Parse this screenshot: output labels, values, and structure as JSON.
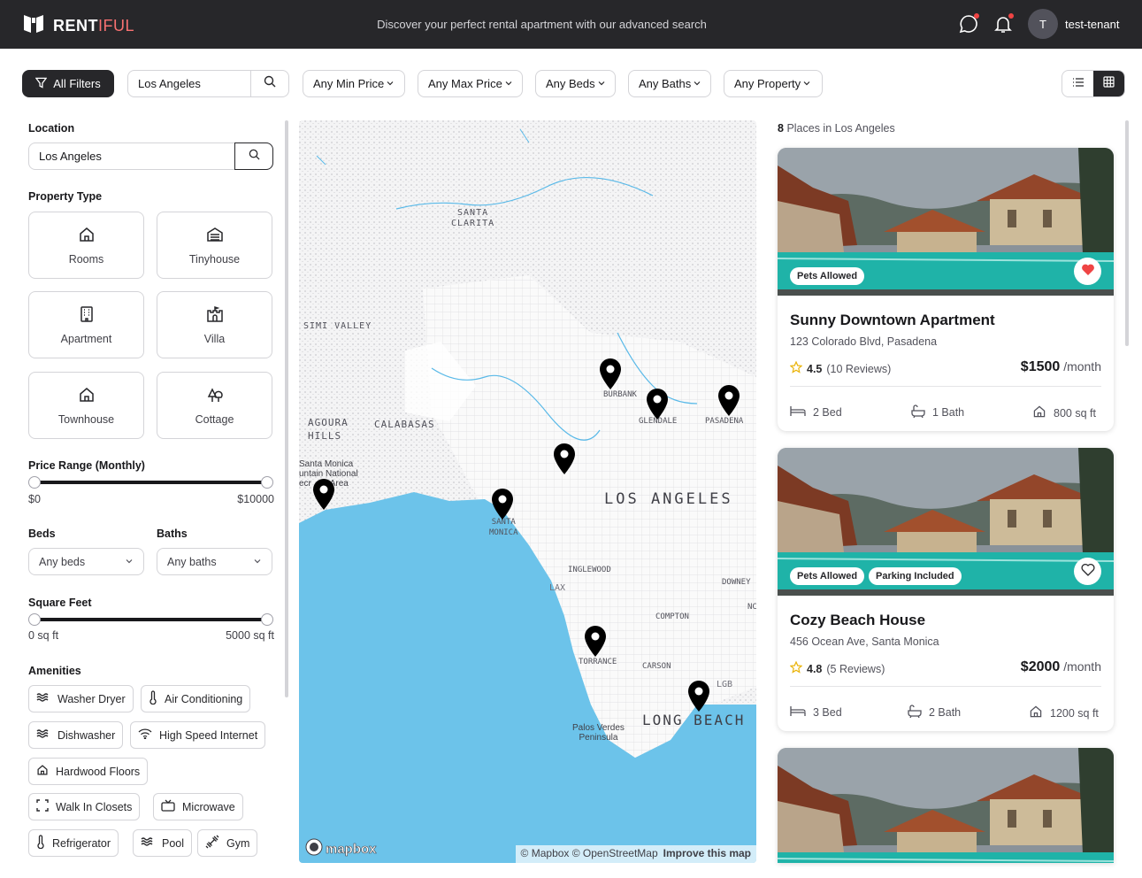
{
  "header": {
    "brand_first": "RENT",
    "brand_second": "IFUL",
    "tagline": "Discover your perfect rental apartment with our advanced search",
    "avatar_initial": "T",
    "username": "test-tenant",
    "icons": [
      "logo-icon",
      "message-icon",
      "bell-icon"
    ]
  },
  "filterbar": {
    "all_filters": "All Filters",
    "search_value": "Los Angeles",
    "min_price": "Any Min Price",
    "max_price": "Any Max Price",
    "beds": "Any Beds",
    "baths": "Any Baths",
    "property": "Any Property",
    "view_modes": [
      "list-icon",
      "grid-icon"
    ]
  },
  "sidebar": {
    "location_label": "Location",
    "location_value": "Los Angeles",
    "property_type_label": "Property Type",
    "property_types": [
      {
        "label": "Rooms",
        "icon": "home-icon"
      },
      {
        "label": "Tinyhouse",
        "icon": "warehouse-icon"
      },
      {
        "label": "Apartment",
        "icon": "building-icon"
      },
      {
        "label": "Villa",
        "icon": "castle-icon"
      },
      {
        "label": "Townhouse",
        "icon": "home-icon"
      },
      {
        "label": "Cottage",
        "icon": "trees-icon"
      }
    ],
    "price_label": "Price Range (Monthly)",
    "price_min": "$0",
    "price_max": "$10000",
    "beds_label": "Beds",
    "beds_value": "Any beds",
    "baths_label": "Baths",
    "baths_value": "Any baths",
    "sqft_label": "Square Feet",
    "sqft_min": "0 sq ft",
    "sqft_max": "5000 sq ft",
    "amenities_label": "Amenities",
    "amenities": [
      {
        "label": "Washer Dryer",
        "icon": "waves-icon"
      },
      {
        "label": "Air Conditioning",
        "icon": "thermometer-icon"
      },
      {
        "label": "Dishwasher",
        "icon": "waves-icon"
      },
      {
        "label": "High Speed Internet",
        "icon": "wifi-icon"
      },
      {
        "label": "Hardwood Floors",
        "icon": "home-icon"
      },
      {
        "label": "Walk In Closets",
        "icon": "maximize-icon"
      },
      {
        "label": "Microwave",
        "icon": "tv-icon"
      },
      {
        "label": "Refrigerator",
        "icon": "thermometer-icon"
      },
      {
        "label": "Pool",
        "icon": "waves-icon"
      },
      {
        "label": "Gym",
        "icon": "dumbbell-icon"
      }
    ]
  },
  "map": {
    "labels": {
      "santa_clarita_1": "SANTA",
      "santa_clarita_2": "CLARITA",
      "simi_valley": "SIMI VALLEY",
      "agoura_1": "AGOURA",
      "agoura_2": "HILLS",
      "calabasas": "CALABASAS",
      "smm_1": "Santa Monica",
      "smm_2": "untain National",
      "smm_3": "ecr",
      "smm_4": "Area",
      "burbank": "BURBANK",
      "glendale": "GLENDALE",
      "pasadena": "PASADENA",
      "los_angeles": "LOS ANGELES",
      "santa_monica_1": "SANTA",
      "santa_monica_2": "MONICA",
      "inglewood": "INGLEWOOD",
      "lax": "LAX",
      "downey": "DOWNEY",
      "nc": "NC",
      "compton": "COMPTON",
      "torrance": "TORRANCE",
      "carson": "CARSON",
      "lgb": "LGB",
      "long_beach": "LONG BEACH",
      "pvp_1": "Palos Verdes",
      "pvp_2": "Peninsula"
    },
    "attribution": "© Mapbox © OpenStreetMap",
    "improve": "Improve this map",
    "mapbox_logo": "mapbox"
  },
  "listings": {
    "count": "8",
    "count_suffix": "Places in Los Angeles",
    "cards": [
      {
        "title": "Sunny Downtown Apartment",
        "address": "123 Colorado Blvd, Pasadena",
        "rating": "4.5",
        "reviews": "(10 Reviews)",
        "price": "$1500",
        "per": "/month",
        "badges": [
          "Pets Allowed"
        ],
        "favorite": true,
        "beds": "2 Bed",
        "baths": "1 Bath",
        "sqft": "800 sq ft"
      },
      {
        "title": "Cozy Beach House",
        "address": "456 Ocean Ave, Santa Monica",
        "rating": "4.8",
        "reviews": "(5 Reviews)",
        "price": "$2000",
        "per": "/month",
        "badges": [
          "Pets Allowed",
          "Parking Included"
        ],
        "favorite": false,
        "beds": "3 Bed",
        "baths": "2 Bath",
        "sqft": "1200 sq ft"
      }
    ]
  },
  "colors": {
    "dark": "#27272a",
    "brand_accent": "#f87171",
    "notification": "#ef4444",
    "water": "#6cc3ea",
    "pool": "#1fb3a8",
    "heart": "#ef4444",
    "star": "#eab308"
  }
}
